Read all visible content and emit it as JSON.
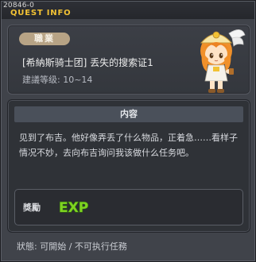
{
  "window": {
    "id_text": "20846-0",
    "title": "QUEST INFO"
  },
  "quest": {
    "job_badge": "職業",
    "name": "[希納斯骑士团] 丢失的搜索证1",
    "level_range": "建議等级: 10~14"
  },
  "content": {
    "header": "内容",
    "description": "见到了布吉。他好像弄丢了什么物品，正着急……看样子情况不妙，去向布吉询问我该做什么任务吧。"
  },
  "reward": {
    "label": "獎勵",
    "exp_text": "EXP"
  },
  "status": {
    "text": "狀態: 可開始 / 不可执行任務"
  },
  "colors": {
    "title_accent": "#f2c234",
    "badge": "#b7a385",
    "exp_green": "#7ed321"
  },
  "icons": {
    "npc": "npc-character-portrait",
    "exp": "exp-icon"
  }
}
